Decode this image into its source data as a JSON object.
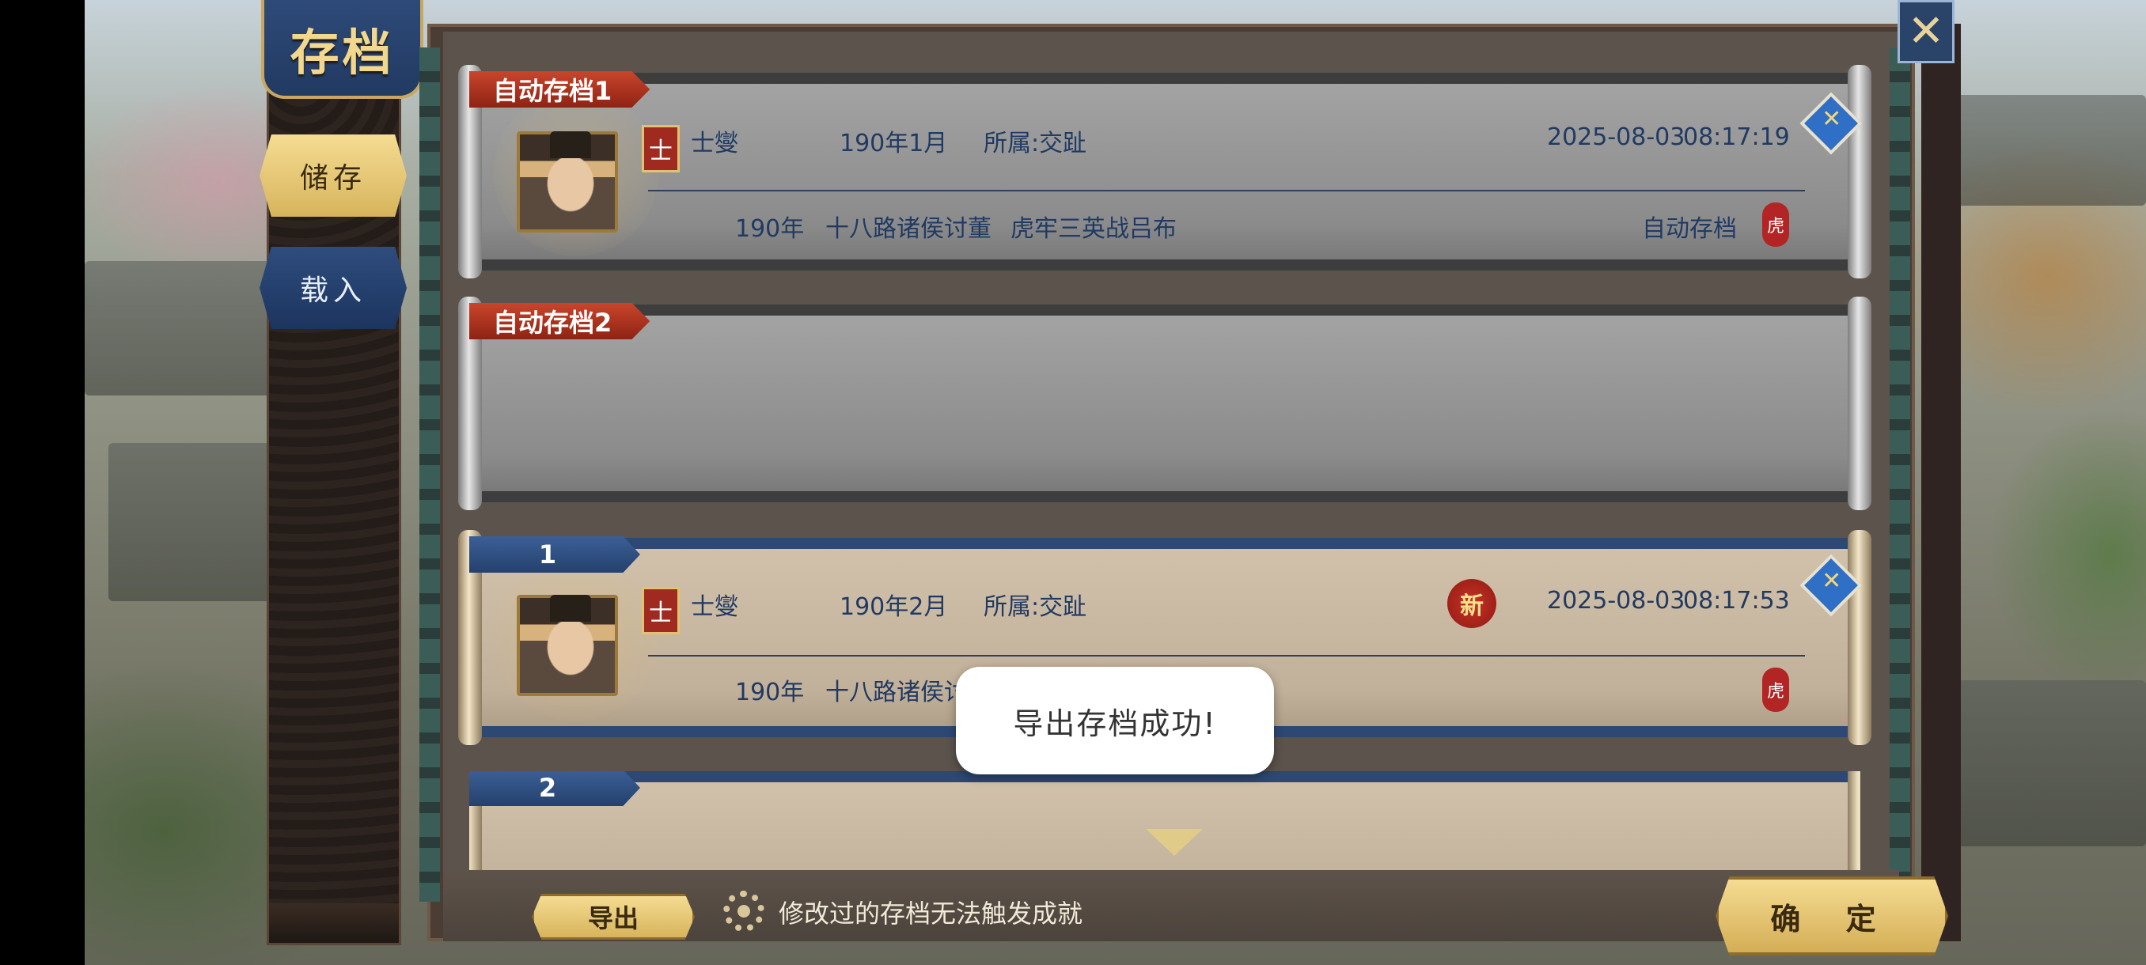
{
  "window": {
    "title": "存档"
  },
  "tabs": {
    "save": "储存",
    "load": "载入"
  },
  "slots": [
    {
      "label": "自动存档1",
      "general": "士燮",
      "class_badge": "士",
      "date": "190年1月",
      "faction": "所属:交趾",
      "saved_date": "2025-08-03",
      "saved_time": "08:17:19",
      "scenario_year": "190年",
      "scenario_name": "十八路诸侯讨董",
      "scenario_event": "虎牢三英战吕布",
      "save_type": "自动存档",
      "difficulty_badge": "虎"
    },
    {
      "label": "自动存档2"
    },
    {
      "label": "1",
      "general": "士燮",
      "class_badge": "士",
      "date": "190年2月",
      "faction": "所属:交趾",
      "new_badge": "新",
      "saved_date": "2025-08-03",
      "saved_time": "08:17:53",
      "scenario_year": "190年",
      "scenario_name": "十八路诸侯讨",
      "difficulty_badge": "虎"
    },
    {
      "label": "2"
    }
  ],
  "toast": {
    "message": "导出存档成功!"
  },
  "footer": {
    "export_label": "导出",
    "hint": "修改过的存档无法触发成就",
    "confirm_label": "确 定"
  },
  "icons": {
    "close": "close-icon",
    "kite": "kite-icon",
    "gear": "gear-icon",
    "scroll_down": "chevron-down-icon"
  },
  "colors": {
    "text_navy": "#203a62",
    "label_red": "#8e2313",
    "label_blue": "#24416d",
    "gold": "#d7b45c"
  }
}
